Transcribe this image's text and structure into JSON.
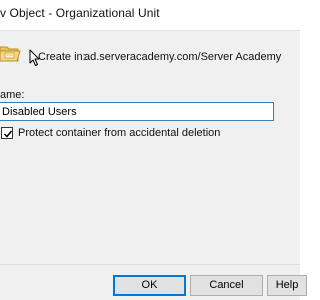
{
  "window": {
    "title": "v Object - Organizational Unit"
  },
  "create_in": {
    "label": "Create in:",
    "path": "ad.serveracademy.com/Server Academy"
  },
  "name_field": {
    "label": "ame:",
    "value": "Disabled Users"
  },
  "protect_checkbox": {
    "label": "Protect container from accidental deletion",
    "checked": true
  },
  "buttons": {
    "ok": "OK",
    "cancel": "Cancel",
    "help": "Help"
  },
  "icons": {
    "ou": "organizational-unit-folder-icon",
    "cursor": "mouse-pointer-icon",
    "check": "checkmark-icon"
  },
  "colors": {
    "input_focus_border": "#3c7fb1",
    "default_button_border": "#0078d7",
    "dialog_background": "#f0f0f0"
  }
}
